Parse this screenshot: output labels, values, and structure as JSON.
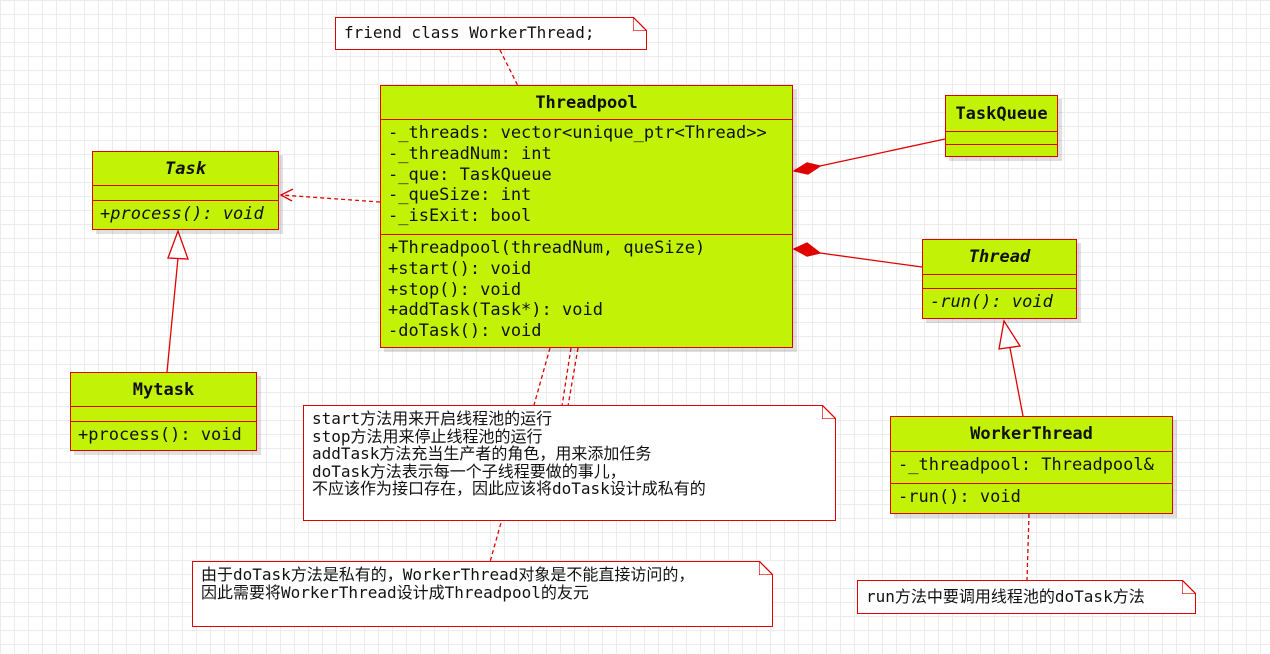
{
  "classes": {
    "threadpool": {
      "name": "Threadpool",
      "attributes": [
        "-_threads: vector<unique_ptr<Thread>>",
        "-_threadNum: int",
        "-_que: TaskQueue",
        "-_queSize: int",
        "-_isExit: bool"
      ],
      "operations": [
        "+Threadpool(threadNum, queSize)",
        "+start(): void",
        "+stop(): void",
        "+addTask(Task*): void",
        "-doTask(): void"
      ]
    },
    "task": {
      "name": "Task",
      "operations": [
        "+process(): void"
      ]
    },
    "mytask": {
      "name": "Mytask",
      "operations": [
        "+process(): void"
      ]
    },
    "taskqueue": {
      "name": "TaskQueue"
    },
    "thread": {
      "name": "Thread",
      "operations": [
        "-run(): void"
      ]
    },
    "workerthread": {
      "name": "WorkerThread",
      "attributes": [
        "-_threadpool: Threadpool&"
      ],
      "operations": [
        "-run(): void"
      ]
    }
  },
  "notes": {
    "friend": [
      "friend class WorkerThread;"
    ],
    "methods": [
      "start方法用来开启线程池的运行",
      "stop方法用来停止线程池的运行",
      "addTask方法充当生产者的角色，用来添加任务",
      "doTask方法表示每一个子线程要做的事儿，",
      "不应该作为接口存在，因此应该将doTask设计成私有的"
    ],
    "dotask_private": [
      "由于doTask方法是私有的，WorkerThread对象是不能直接访问的，",
      "因此需要将WorkerThread设计成Threadpool的友元"
    ],
    "run": [
      "run方法中要调用线程池的doTask方法"
    ]
  },
  "colors": {
    "class_fill": "#c2f205",
    "border": "#e00000",
    "note_fill": "#ffffff"
  }
}
